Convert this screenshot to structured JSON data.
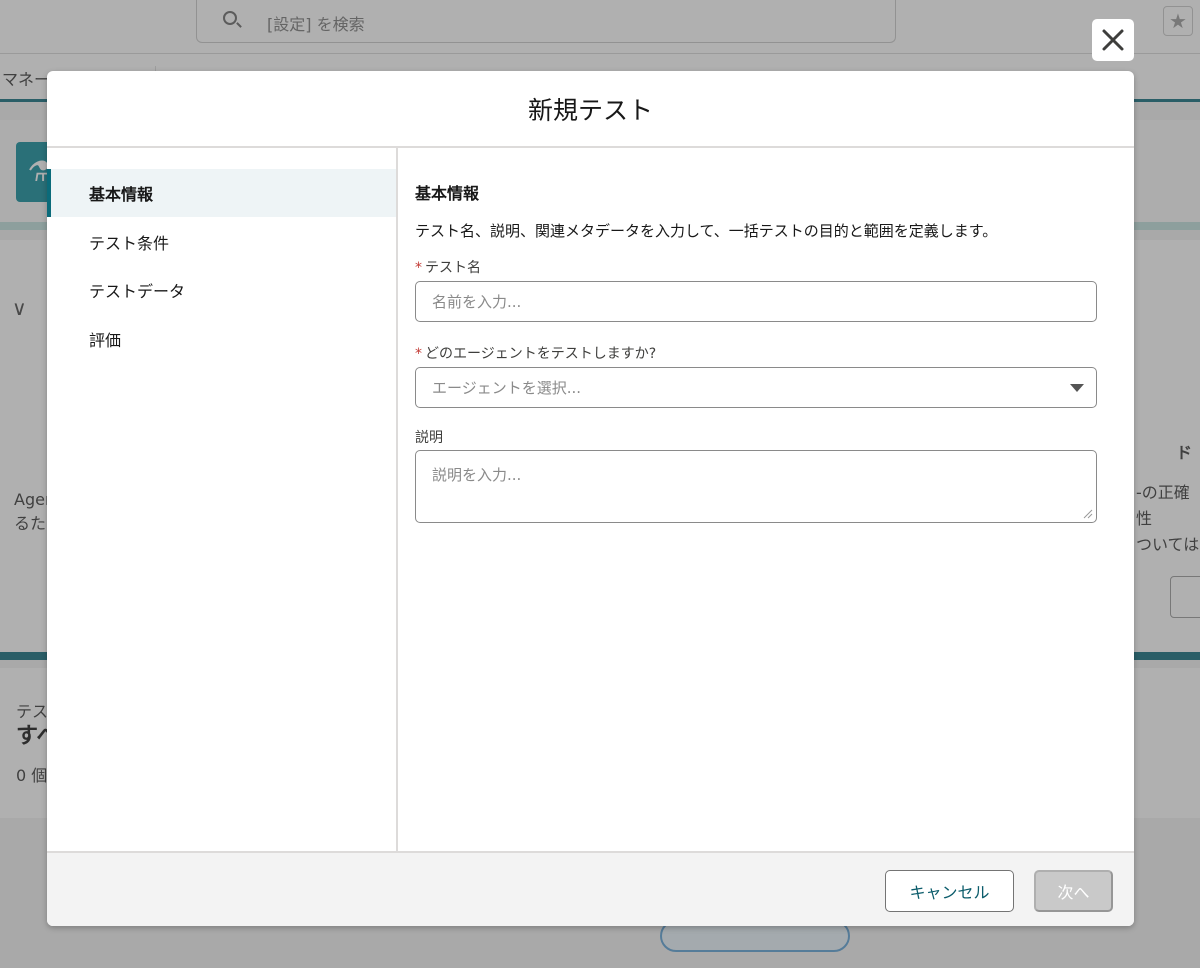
{
  "background": {
    "search_placeholder": "[設定] を検索",
    "tab_label": "マネー",
    "agent_text_line1": "Ager",
    "agent_text_line2": "るた",
    "right_text_title": "ド",
    "right_text_line1": "-の正確性",
    "right_text_line2": "ついては",
    "lower_label": "テス",
    "lower_title": "すべ",
    "lower_count": "0 個"
  },
  "modal": {
    "title": "新規テスト",
    "nav": [
      {
        "label": "基本情報",
        "active": true
      },
      {
        "label": "テスト条件",
        "active": false
      },
      {
        "label": "テストデータ",
        "active": false
      },
      {
        "label": "評価",
        "active": false
      }
    ],
    "section": {
      "title": "基本情報",
      "description": "テスト名、説明、関連メタデータを入力して、一括テストの目的と範囲を定義します。"
    },
    "fields": {
      "test_name": {
        "label": "テスト名",
        "required": true,
        "placeholder": "名前を入力..."
      },
      "agent": {
        "label": "どのエージェントをテストしますか?",
        "required": true,
        "placeholder": "エージェントを選択..."
      },
      "description": {
        "label": "説明",
        "required": false,
        "placeholder": "説明を入力..."
      }
    },
    "footer": {
      "cancel_label": "キャンセル",
      "next_label": "次へ"
    }
  }
}
